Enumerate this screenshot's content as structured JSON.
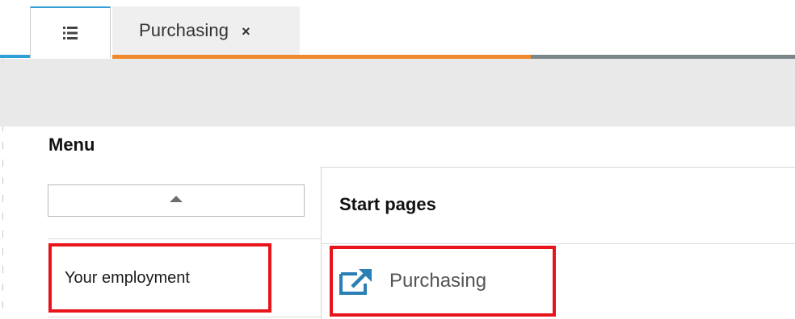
{
  "tabs": [
    {
      "icon": "menu-list-icon"
    },
    {
      "label": "Purchasing",
      "close_glyph": "×"
    }
  ],
  "menu": {
    "heading": "Menu",
    "collapse_icon": "triangle-up-icon",
    "items": [
      {
        "label": "Your employment"
      }
    ]
  },
  "start_pages": {
    "title": "Start pages",
    "links": [
      {
        "label": "Purchasing",
        "icon": "external-link-icon"
      }
    ]
  },
  "colors": {
    "active_tab_accent": "#2f9fd8",
    "tab_underline_orange": "#f0892c",
    "tab_underline_gray": "#7b8689",
    "highlight_red": "#e8141b",
    "link_icon_blue": "#2a7fb4"
  }
}
